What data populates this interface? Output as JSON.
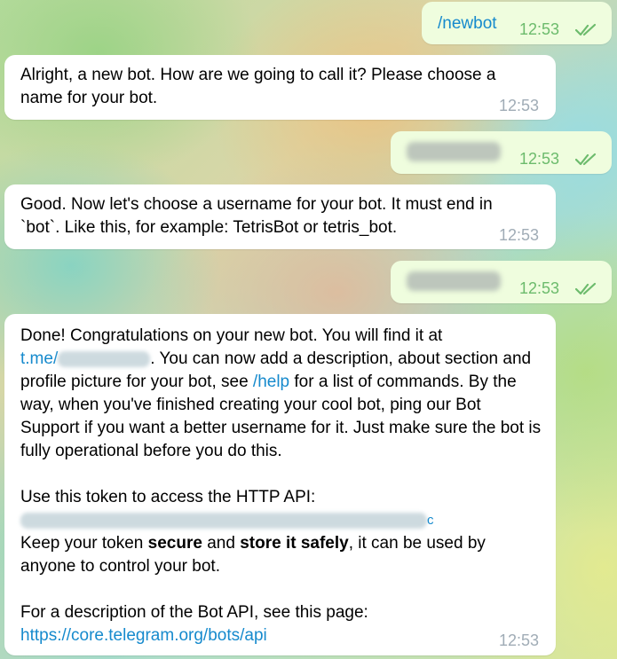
{
  "messages": {
    "m1": {
      "text": "/newbot",
      "time": "12:53"
    },
    "m2": {
      "text": "Alright, a new bot. How are we going to call it? Please choose a name for your bot.",
      "time": "12:53"
    },
    "m3": {
      "time": "12:53"
    },
    "m4": {
      "text": "Good. Now let's choose a username for your bot. It must end in `bot`. Like this, for example: TetrisBot or tetris_bot.",
      "time": "12:53"
    },
    "m5": {
      "time": "12:53"
    },
    "m6": {
      "time": "12:53",
      "line1": "Done! Congratulations on your new bot. You will find it at",
      "link_prefix": "t.me/",
      "after_link": ". You can now add a description, about section and profile picture for your bot, see ",
      "help_cmd": "/help",
      "after_help": " for a list of commands. By the way, when you've finished creating your cool bot, ping our Bot Support if you want a better username for it. Just make sure the bot is fully operational before you do this.",
      "token_intro": "Use this token to access the HTTP API:",
      "token_tail": "c",
      "keep_pre": "Keep your token ",
      "keep_bold1": "secure",
      "keep_mid": " and ",
      "keep_bold2": "store it safely",
      "keep_post": ", it can be used by anyone to control your bot.",
      "api_intro": "For a description of the Bot API, see this page:",
      "api_url": "https://core.telegram.org/bots/api"
    }
  },
  "colors": {
    "outgoing": "#effdde",
    "incoming": "#ffffff",
    "link": "#168acd",
    "check": "#6cbb6c"
  },
  "icons": {
    "read_receipt": "double-check-icon"
  }
}
